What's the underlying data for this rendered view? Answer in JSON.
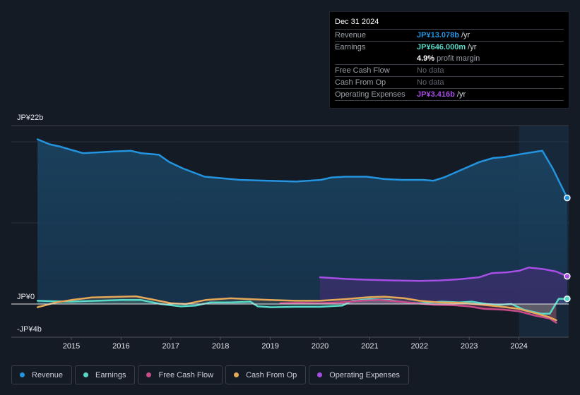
{
  "tooltip": {
    "date": "Dec 31 2024",
    "rows": [
      {
        "label": "Revenue",
        "value": "JP¥13.078b",
        "unit": " /yr",
        "color": "#2394df"
      },
      {
        "label": "Earnings",
        "value": "JP¥646.000m",
        "unit": " /yr",
        "color": "#58d9c8"
      },
      {
        "label": "",
        "value": "4.9%",
        "unit": " profit margin",
        "color": "#ffffff"
      },
      {
        "label": "Free Cash Flow",
        "value": "No data",
        "unit": "",
        "color": "#5f656d"
      },
      {
        "label": "Cash From Op",
        "value": "No data",
        "unit": "",
        "color": "#5f656d"
      },
      {
        "label": "Operating Expenses",
        "value": "JP¥3.416b",
        "unit": " /yr",
        "color": "#a64ee6"
      }
    ]
  },
  "legend": [
    {
      "label": "Revenue",
      "color": "#2394df"
    },
    {
      "label": "Earnings",
      "color": "#58d9c8"
    },
    {
      "label": "Free Cash Flow",
      "color": "#c84b8a"
    },
    {
      "label": "Cash From Op",
      "color": "#e6a95a"
    },
    {
      "label": "Operating Expenses",
      "color": "#a64ee6"
    }
  ],
  "chart_data": {
    "type": "area",
    "title": "",
    "xlabel": "",
    "ylabel": "",
    "unit": "JP¥ billions",
    "ylim": [
      -4,
      22
    ],
    "y_tick_labels": [
      {
        "value": 22,
        "label": "JP¥22b"
      },
      {
        "value": 0,
        "label": "JP¥0"
      },
      {
        "value": -4,
        "label": "-JP¥4b"
      }
    ],
    "gridlines": [
      0,
      10,
      20
    ],
    "x_ticks": [
      2015,
      2016,
      2017,
      2018,
      2019,
      2020,
      2021,
      2022,
      2023,
      2024
    ],
    "xlim": [
      2013.3,
      2024.97
    ],
    "highlight_from": 2024.0,
    "series": [
      {
        "name": "Revenue",
        "color": "#2394df",
        "points": [
          [
            2014.32,
            20.3
          ],
          [
            2014.56,
            19.7
          ],
          [
            2014.78,
            19.4
          ],
          [
            2015.0,
            19.0
          ],
          [
            2015.23,
            18.6
          ],
          [
            2015.55,
            18.7
          ],
          [
            2015.84,
            18.8
          ],
          [
            2016.19,
            18.9
          ],
          [
            2016.4,
            18.6
          ],
          [
            2016.76,
            18.4
          ],
          [
            2016.97,
            17.5
          ],
          [
            2017.25,
            16.7
          ],
          [
            2017.68,
            15.7
          ],
          [
            2018.03,
            15.5
          ],
          [
            2018.39,
            15.3
          ],
          [
            2018.95,
            15.2
          ],
          [
            2019.52,
            15.1
          ],
          [
            2020.02,
            15.3
          ],
          [
            2020.23,
            15.6
          ],
          [
            2020.51,
            15.7
          ],
          [
            2020.94,
            15.7
          ],
          [
            2021.3,
            15.4
          ],
          [
            2021.65,
            15.3
          ],
          [
            2022.07,
            15.3
          ],
          [
            2022.28,
            15.2
          ],
          [
            2022.49,
            15.6
          ],
          [
            2023.2,
            17.5
          ],
          [
            2023.48,
            18.0
          ],
          [
            2023.69,
            18.1
          ],
          [
            2024.05,
            18.5
          ],
          [
            2024.47,
            18.9
          ],
          [
            2024.68,
            16.7
          ],
          [
            2024.97,
            13.078
          ]
        ]
      },
      {
        "name": "Earnings",
        "color": "#58d9c8",
        "points": [
          [
            2014.32,
            0.4
          ],
          [
            2014.6,
            0.35
          ],
          [
            2015.0,
            0.3
          ],
          [
            2015.5,
            0.4
          ],
          [
            2016.0,
            0.5
          ],
          [
            2016.4,
            0.5
          ],
          [
            2016.8,
            0.0
          ],
          [
            2017.2,
            -0.3
          ],
          [
            2017.5,
            -0.2
          ],
          [
            2017.8,
            0.2
          ],
          [
            2018.2,
            0.2
          ],
          [
            2018.6,
            0.3
          ],
          [
            2018.75,
            -0.3
          ],
          [
            2019.0,
            -0.4
          ],
          [
            2019.5,
            -0.35
          ],
          [
            2020.0,
            -0.35
          ],
          [
            2020.45,
            -0.2
          ],
          [
            2020.65,
            0.4
          ],
          [
            2021.0,
            0.6
          ],
          [
            2021.4,
            0.5
          ],
          [
            2021.7,
            0.2
          ],
          [
            2022.0,
            0.1
          ],
          [
            2022.45,
            0.3
          ],
          [
            2022.8,
            0.2
          ],
          [
            2023.05,
            0.3
          ],
          [
            2023.35,
            0.0
          ],
          [
            2023.6,
            -0.1
          ],
          [
            2023.85,
            0.0
          ],
          [
            2024.1,
            -0.7
          ],
          [
            2024.45,
            -1.2
          ],
          [
            2024.62,
            -1.2
          ],
          [
            2024.8,
            0.646
          ],
          [
            2024.97,
            0.646
          ]
        ]
      },
      {
        "name": "Free Cash Flow",
        "color": "#c84b8a",
        "points": [
          [
            2019.2,
            0.1
          ],
          [
            2019.6,
            0.15
          ],
          [
            2020.0,
            0.1
          ],
          [
            2020.4,
            0.2
          ],
          [
            2020.8,
            0.4
          ],
          [
            2021.2,
            0.5
          ],
          [
            2021.6,
            0.3
          ],
          [
            2022.0,
            0.05
          ],
          [
            2022.3,
            -0.1
          ],
          [
            2022.7,
            -0.15
          ],
          [
            2023.0,
            -0.3
          ],
          [
            2023.3,
            -0.6
          ],
          [
            2023.7,
            -0.7
          ],
          [
            2024.0,
            -0.9
          ],
          [
            2024.3,
            -1.4
          ],
          [
            2024.62,
            -1.8
          ],
          [
            2024.75,
            -2.3
          ]
        ]
      },
      {
        "name": "Cash From Op",
        "color": "#e6a95a",
        "points": [
          [
            2014.32,
            -0.4
          ],
          [
            2014.7,
            0.2
          ],
          [
            2015.0,
            0.5
          ],
          [
            2015.4,
            0.8
          ],
          [
            2016.0,
            0.9
          ],
          [
            2016.3,
            0.95
          ],
          [
            2016.6,
            0.6
          ],
          [
            2017.0,
            0.1
          ],
          [
            2017.3,
            0.0
          ],
          [
            2017.7,
            0.5
          ],
          [
            2018.2,
            0.7
          ],
          [
            2018.6,
            0.6
          ],
          [
            2019.0,
            0.5
          ],
          [
            2019.5,
            0.4
          ],
          [
            2020.0,
            0.4
          ],
          [
            2020.5,
            0.6
          ],
          [
            2021.0,
            0.85
          ],
          [
            2021.3,
            0.9
          ],
          [
            2021.7,
            0.7
          ],
          [
            2022.0,
            0.4
          ],
          [
            2022.4,
            0.2
          ],
          [
            2022.8,
            0.15
          ],
          [
            2023.2,
            -0.05
          ],
          [
            2023.6,
            -0.3
          ],
          [
            2024.0,
            -0.6
          ],
          [
            2024.3,
            -1.1
          ],
          [
            2024.6,
            -1.6
          ],
          [
            2024.75,
            -2.0
          ]
        ]
      },
      {
        "name": "Operating Expenses",
        "color": "#a64ee6",
        "points": [
          [
            2020.0,
            3.3
          ],
          [
            2020.5,
            3.1
          ],
          [
            2020.9,
            3.0
          ],
          [
            2021.5,
            2.9
          ],
          [
            2022.0,
            2.85
          ],
          [
            2022.4,
            2.9
          ],
          [
            2022.8,
            3.05
          ],
          [
            2023.2,
            3.3
          ],
          [
            2023.45,
            3.8
          ],
          [
            2023.75,
            3.9
          ],
          [
            2024.0,
            4.1
          ],
          [
            2024.2,
            4.5
          ],
          [
            2024.5,
            4.3
          ],
          [
            2024.75,
            4.0
          ],
          [
            2024.97,
            3.416
          ]
        ]
      }
    ]
  }
}
